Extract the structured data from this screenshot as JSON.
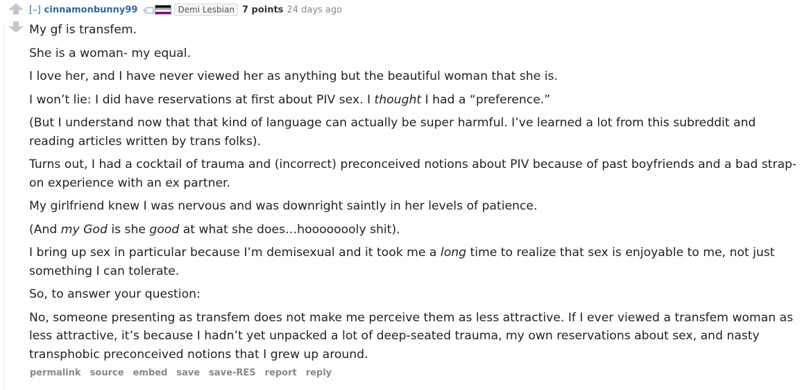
{
  "comment": {
    "collapse_label": "[–]",
    "author": "cinnamonbunny99",
    "flair": {
      "text": "Demi Lesbian",
      "flag_icon": "asexual-flag-icon",
      "flag_colors": [
        "#000000",
        "#a3a3a3",
        "#ffffff",
        "#800080"
      ]
    },
    "score": "7 points",
    "time": "24 days ago",
    "paragraphs": [
      {
        "parts": [
          {
            "text": "My gf is transfem."
          }
        ]
      },
      {
        "parts": [
          {
            "text": "She is a woman- my equal."
          }
        ]
      },
      {
        "parts": [
          {
            "text": "I love her, and I have never viewed her as anything but the beautiful woman that she is."
          }
        ]
      },
      {
        "parts": [
          {
            "text": "I won’t lie: I did have reservations at first about PIV sex. I "
          },
          {
            "text": "thought",
            "em": true
          },
          {
            "text": " I had a “preference.”"
          }
        ]
      },
      {
        "parts": [
          {
            "text": "(But I understand now that that kind of language can actually be super harmful. I’ve learned a lot from this subreddit and reading articles written by trans folks)."
          }
        ]
      },
      {
        "parts": [
          {
            "text": "Turns out, I had a cocktail of trauma and (incorrect) preconceived notions about PIV because of past boyfriends and a bad strap-on experience with an ex partner."
          }
        ]
      },
      {
        "parts": [
          {
            "text": "My girlfriend knew I was nervous and was downright saintly in her levels of patience."
          }
        ]
      },
      {
        "parts": [
          {
            "text": "(And "
          },
          {
            "text": "my God",
            "em": true
          },
          {
            "text": " is she "
          },
          {
            "text": "good",
            "em": true
          },
          {
            "text": " at what she does…hoooooooly shit)."
          }
        ]
      },
      {
        "parts": [
          {
            "text": "I bring up sex in particular because I’m demisexual and it took me a "
          },
          {
            "text": "long",
            "em": true
          },
          {
            "text": " time to realize that sex is enjoyable to me, not just something I can tolerate."
          }
        ]
      },
      {
        "parts": [
          {
            "text": "So, to answer your question:"
          }
        ]
      },
      {
        "parts": [
          {
            "text": "No, someone presenting as transfem does not make me perceive them as less attractive. If I ever viewed a transfem woman as less attractive, it’s because I hadn’t yet unpacked a lot of deep-seated trauma, my own reservations about sex, and nasty transphobic preconceived notions that I grew up around."
          }
        ]
      }
    ],
    "buttons": [
      "permalink",
      "source",
      "embed",
      "save",
      "save-RES",
      "report",
      "reply"
    ],
    "colors": {
      "link": "#336699",
      "text": "#222222",
      "muted": "#888888",
      "arrow": "#c6c6c6"
    }
  }
}
